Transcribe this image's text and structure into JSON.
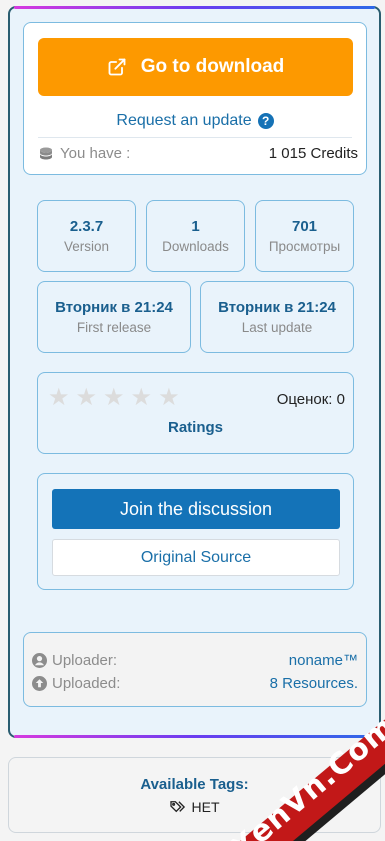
{
  "download": {
    "button_label": "Go to download",
    "request_label": "Request an update",
    "credits_label": "You have :",
    "credits_value": "1 015 Credits"
  },
  "stats": [
    {
      "value": "2.3.7",
      "label": "Version"
    },
    {
      "value": "1",
      "label": "Downloads"
    },
    {
      "value": "701",
      "label": "Просмотры"
    },
    {
      "value": "Вторник в 21:24",
      "label": "First release"
    },
    {
      "value": "Вторник в 21:24",
      "label": "Last update"
    }
  ],
  "rating": {
    "stars": 5,
    "filled": 0,
    "score_label": "Оценок: 0",
    "title": "Ratings"
  },
  "discussion": {
    "join_label": "Join the discussion",
    "source_label": "Original Source"
  },
  "uploader": {
    "uploader_label": "Uploader:",
    "uploader_value": "noname™",
    "uploaded_label": "Uploaded:",
    "uploaded_value": "8 Resources."
  },
  "tags": {
    "title": "Available Tags:",
    "tag": "НЕТ"
  },
  "watermark": "XenVn.Com",
  "colors": {
    "accent_orange": "#fd9900",
    "primary_blue": "#1473b8",
    "link_blue": "#1a6fa8"
  }
}
